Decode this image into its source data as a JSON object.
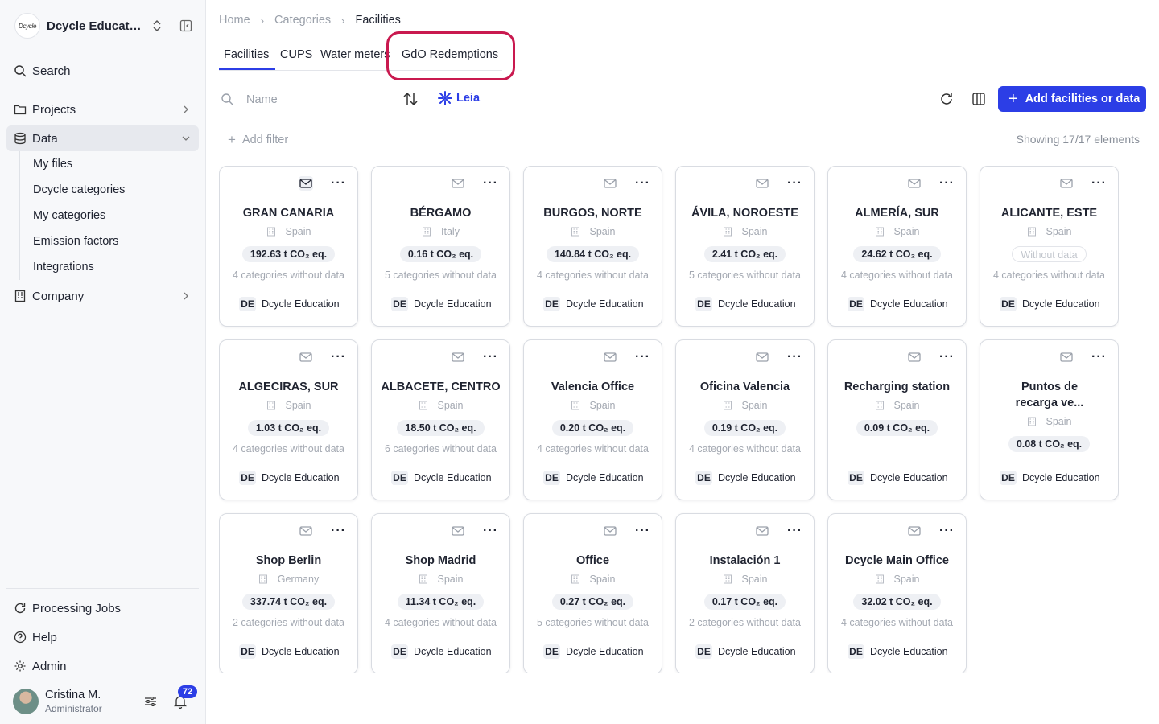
{
  "sidebar": {
    "org_logo": "Dcycle",
    "org_name": "Dcycle Education",
    "search_label": "Search",
    "items": {
      "projects": "Projects",
      "data": "Data",
      "company": "Company"
    },
    "data_subitems": [
      "My files",
      "Dcycle categories",
      "My categories",
      "Emission factors",
      "Integrations"
    ],
    "bottom": {
      "processing_jobs": "Processing Jobs",
      "help": "Help",
      "admin": "Admin"
    },
    "user": {
      "name": "Cristina M.",
      "role": "Administrator",
      "notifications": "72"
    }
  },
  "breadcrumb": [
    "Home",
    "Categories",
    "Facilities"
  ],
  "tabs": [
    "Facilities",
    "CUPS",
    "Water meters",
    "GdO Redemptions"
  ],
  "toolbar": {
    "search_placeholder": "Name",
    "leia_label": "Leia",
    "add_button": "Add facilities or data",
    "add_filter": "Add filter",
    "showing": "Showing 17/17 elements"
  },
  "accent_color": "#2c3ee6",
  "highlight_color": "#c9194f",
  "cards": [
    {
      "name": "GRAN CANARIA",
      "country": "Spain",
      "co2": "192.63 t CO₂ eq.",
      "missing": "4 categories without data",
      "owner_initials": "DE",
      "owner": "Dcycle Education"
    },
    {
      "name": "BÉRGAMO",
      "country": "Italy",
      "co2": "0.16 t CO₂ eq.",
      "missing": "5 categories without data",
      "owner_initials": "DE",
      "owner": "Dcycle Education"
    },
    {
      "name": "BURGOS, NORTE",
      "country": "Spain",
      "co2": "140.84 t CO₂ eq.",
      "missing": "4 categories without data",
      "owner_initials": "DE",
      "owner": "Dcycle Education"
    },
    {
      "name": "ÁVILA, NOROESTE",
      "country": "Spain",
      "co2": "2.41 t CO₂ eq.",
      "missing": "5 categories without data",
      "owner_initials": "DE",
      "owner": "Dcycle Education"
    },
    {
      "name": "ALMERÍA, SUR",
      "country": "Spain",
      "co2": "24.62 t CO₂ eq.",
      "missing": "4 categories without data",
      "owner_initials": "DE",
      "owner": "Dcycle Education"
    },
    {
      "name": "ALICANTE, ESTE",
      "country": "Spain",
      "co2": "Without data",
      "missing": "4 categories without data",
      "owner_initials": "DE",
      "owner": "Dcycle Education"
    },
    {
      "name": "ALGECIRAS, SUR",
      "country": "Spain",
      "co2": "1.03 t CO₂ eq.",
      "missing": "4 categories without data",
      "owner_initials": "DE",
      "owner": "Dcycle Education"
    },
    {
      "name": "ALBACETE, CENTRO",
      "country": "Spain",
      "co2": "18.50 t CO₂ eq.",
      "missing": "6 categories without data",
      "owner_initials": "DE",
      "owner": "Dcycle Education"
    },
    {
      "name": "Valencia Office",
      "country": "Spain",
      "co2": "0.20 t CO₂ eq.",
      "missing": "4 categories without data",
      "owner_initials": "DE",
      "owner": "Dcycle Education"
    },
    {
      "name": "Oficina Valencia",
      "country": "Spain",
      "co2": "0.19 t CO₂ eq.",
      "missing": "4 categories without data",
      "owner_initials": "DE",
      "owner": "Dcycle Education"
    },
    {
      "name": "Recharging station",
      "country": "Spain",
      "co2": "0.09 t CO₂ eq.",
      "missing": "",
      "owner_initials": "DE",
      "owner": "Dcycle Education"
    },
    {
      "name": "Puntos de recarga ve...",
      "country": "Spain",
      "co2": "0.08 t CO₂ eq.",
      "missing": "",
      "owner_initials": "DE",
      "owner": "Dcycle Education"
    },
    {
      "name": "Shop Berlin",
      "country": "Germany",
      "co2": "337.74 t CO₂ eq.",
      "missing": "2 categories without data",
      "owner_initials": "DE",
      "owner": "Dcycle Education"
    },
    {
      "name": "Shop Madrid",
      "country": "Spain",
      "co2": "11.34 t CO₂ eq.",
      "missing": "4 categories without data",
      "owner_initials": "DE",
      "owner": "Dcycle Education"
    },
    {
      "name": "Office",
      "country": "Spain",
      "co2": "0.27 t CO₂ eq.",
      "missing": "5 categories without data",
      "owner_initials": "DE",
      "owner": "Dcycle Education"
    },
    {
      "name": "Instalación 1",
      "country": "Spain",
      "co2": "0.17 t CO₂ eq.",
      "missing": "2 categories without data",
      "owner_initials": "DE",
      "owner": "Dcycle Education"
    },
    {
      "name": "Dcycle Main Office",
      "country": "Spain",
      "co2": "32.02 t CO₂ eq.",
      "missing": "4 categories without data",
      "owner_initials": "DE",
      "owner": "Dcycle Education"
    }
  ]
}
